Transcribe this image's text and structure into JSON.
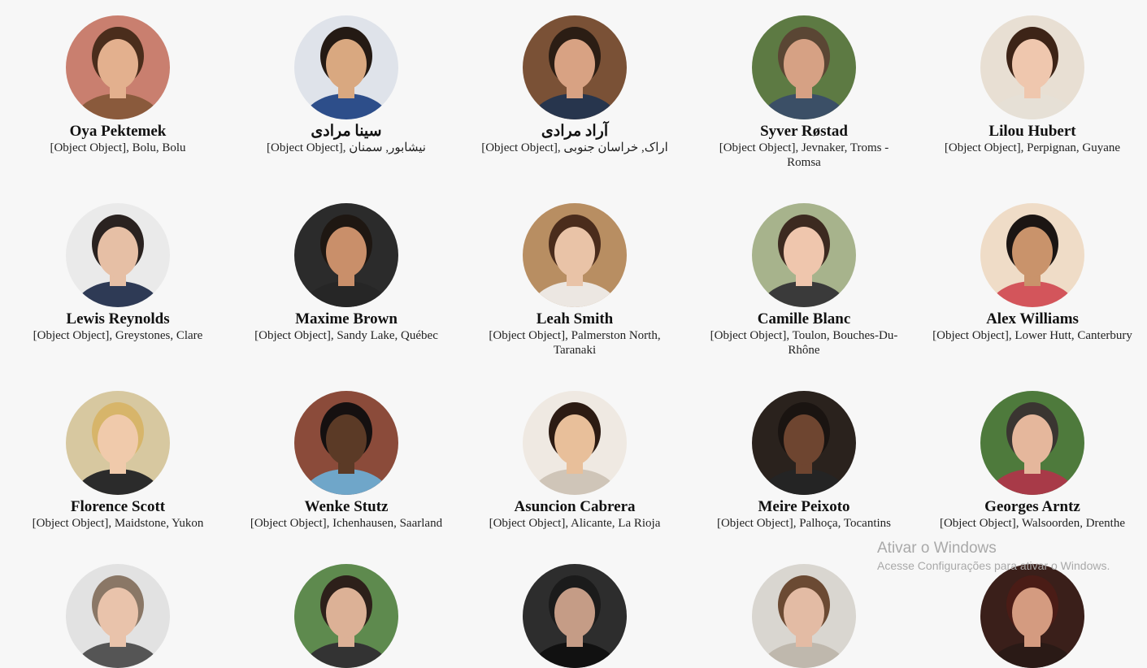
{
  "users": [
    {
      "name": "Oya Pektemek",
      "location": "[Object Object], Bolu, Bolu",
      "bg": "#c97f6f",
      "skin": "#e3b08e",
      "hair": "#4a2d1c",
      "shirt": "#8a5a3c"
    },
    {
      "name": "سینا مرادی",
      "location": "[Object Object], نیشابور, سمنان",
      "bg": "#dfe3ea",
      "skin": "#d9a880",
      "hair": "#241a14",
      "shirt": "#2d4e8a"
    },
    {
      "name": "آراد مرادی",
      "location": "[Object Object], اراک, خراسان جنوبی",
      "bg": "#7a5136",
      "skin": "#d8a283",
      "hair": "#2b1d14",
      "shirt": "#27354d"
    },
    {
      "name": "Syver Røstad",
      "location": "[Object Object], Jevnaker, Troms - Romsa",
      "bg": "#5d7a43",
      "skin": "#d6a184",
      "hair": "#5a4634",
      "shirt": "#3b4f66"
    },
    {
      "name": "Lilou Hubert",
      "location": "[Object Object], Perpignan, Guyane",
      "bg": "#e8dfd3",
      "skin": "#efc7ae",
      "hair": "#3d2417",
      "shirt": "#e6e0d6"
    },
    {
      "name": "Lewis Reynolds",
      "location": "[Object Object], Greystones, Clare",
      "bg": "#eaeaea",
      "skin": "#e6bfa5",
      "hair": "#2a2220",
      "shirt": "#2e3a55"
    },
    {
      "name": "Maxime Brown",
      "location": "[Object Object], Sandy Lake, Québec",
      "bg": "#2b2b2b",
      "skin": "#c98f6a",
      "hair": "#1e1712",
      "shirt": "#262626"
    },
    {
      "name": "Leah Smith",
      "location": "[Object Object], Palmerston North, Taranaki",
      "bg": "#b88e62",
      "skin": "#e9c3a7",
      "hair": "#4a2c1c",
      "shirt": "#ece7e2"
    },
    {
      "name": "Camille Blanc",
      "location": "[Object Object], Toulon, Bouches-Du-Rhône",
      "bg": "#a7b38c",
      "skin": "#efc6ad",
      "hair": "#3c2a20",
      "shirt": "#3a3a3a"
    },
    {
      "name": "Alex Williams",
      "location": "[Object Object], Lower Hutt, Canterbury",
      "bg": "#efdcc7",
      "skin": "#c9936b",
      "hair": "#1b1513",
      "shirt": "#d3555b"
    },
    {
      "name": "Florence Scott",
      "location": "[Object Object], Maidstone, Yukon",
      "bg": "#d7c8a0",
      "skin": "#f0caab",
      "hair": "#d7b56a",
      "shirt": "#2b2b2b"
    },
    {
      "name": "Wenke Stutz",
      "location": "[Object Object], Ichenhausen, Saarland",
      "bg": "#8b4b3a",
      "skin": "#5b3a26",
      "hair": "#151010",
      "shirt": "#6fa6c9"
    },
    {
      "name": "Asuncion Cabrera",
      "location": "[Object Object], Alicante, La Rioja",
      "bg": "#efe9e2",
      "skin": "#e8bf9a",
      "hair": "#2c1b13",
      "shirt": "#cfc5b8"
    },
    {
      "name": "Meire Peixoto",
      "location": "[Object Object], Palhoça, Tocantins",
      "bg": "#2a221d",
      "skin": "#6e4530",
      "hair": "#1a1411",
      "shirt": "#242424"
    },
    {
      "name": "Georges Arntz",
      "location": "[Object Object], Walsoorden, Drenthe",
      "bg": "#4e7a3c",
      "skin": "#e5b79c",
      "hair": "#3a3531",
      "shirt": "#a83a48"
    },
    {
      "bg": "#e2e2e2",
      "skin": "#e9c3ab",
      "hair": "#8a7766",
      "shirt": "#555555"
    },
    {
      "bg": "#5e8a4e",
      "skin": "#dcb196",
      "hair": "#2d201a",
      "shirt": "#333333"
    },
    {
      "bg": "#2d2d2d",
      "skin": "#c59c86",
      "hair": "#1b1b1b",
      "shirt": "#111111"
    },
    {
      "bg": "#d9d6d0",
      "skin": "#e3bba4",
      "hair": "#6b4a33",
      "shirt": "#bfb8ad"
    },
    {
      "bg": "#3a1f1a",
      "skin": "#d49b80",
      "hair": "#4a1c16",
      "shirt": "#2a1a16"
    }
  ],
  "watermark": {
    "title": "Ativar o Windows",
    "subtitle": "Acesse Configurações para ativar o Windows."
  }
}
